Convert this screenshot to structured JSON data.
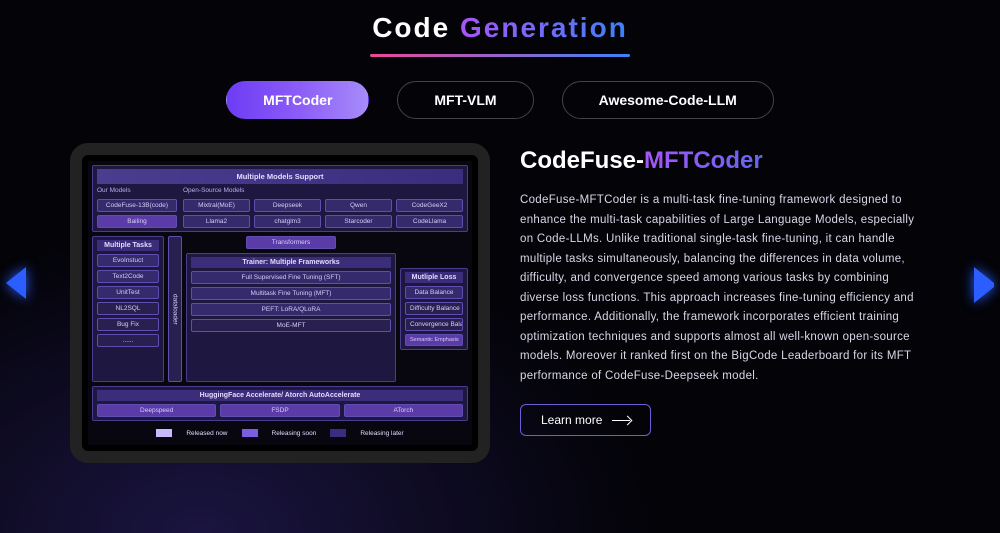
{
  "title": {
    "w1": "Code",
    "w2": "Generation"
  },
  "tabs": [
    "MFTCoder",
    "MFT-VLM",
    "Awesome-Code-LLM"
  ],
  "detail": {
    "name_prefix": "CodeFuse-",
    "name_suffix": "MFTCoder",
    "description": "CodeFuse-MFTCoder is a multi-task fine-tuning framework designed to enhance the multi-task capabilities of Large Language Models, especially on Code-LLMs. Unlike traditional single-task fine-tuning, it can handle multiple tasks simultaneously, balancing the differences in data volume, difficulty, and convergence speed among various tasks by combining diverse loss functions. This approach increases fine-tuning efficiency and performance. Additionally, the framework incorporates efficient training optimization techniques and supports almost all well-known open-source models. Moreover it ranked first on the BigCode Leaderboard for its MFT performance of CodeFuse-Deepseek model.",
    "learn_more": "Learn more"
  },
  "diagram": {
    "top_title": "Multiple Models Support",
    "our_models_label": "Our Models",
    "our_models": [
      "CodeFuse-13B(code)",
      "Bailing"
    ],
    "os_label": "Open-Source Models",
    "os_models": [
      [
        "Mixtral(MoE)",
        "Deepseek",
        "Qwen",
        "CodeGeeX2"
      ],
      [
        "Llama2",
        "chatglm3",
        "Starcoder",
        "CodeLlama"
      ]
    ],
    "transformers": "Transformers",
    "tasks_title": "Multiple Tasks",
    "tasks": [
      "EvoInstuct",
      "Text2Code",
      "UnitTest",
      "NL2SQL",
      "Bug Fix",
      "......"
    ],
    "dataloader": "dataloader",
    "trainer_title": "Trainer: Multiple Frameworks",
    "trainer_items": [
      "Full Supervised Fine Tuning (SFT)",
      "Multitask Fine Tuning (MFT)",
      "PEFT: LoRA/QLoRA",
      "MoE-MFT"
    ],
    "loss_title": "Mutliple Loss",
    "loss_items": [
      "Data Balance",
      "Difficulty Balance",
      "Convergence Balance",
      "Semantic Emphasis"
    ],
    "accel": "HuggingFace Accelerate/ Atorch AutoAccelerate",
    "accel_items": [
      "Deepspeed",
      "FSDP",
      "ATorch"
    ],
    "legend": [
      "Released now",
      "Releasing soon",
      "Releasing later"
    ]
  }
}
